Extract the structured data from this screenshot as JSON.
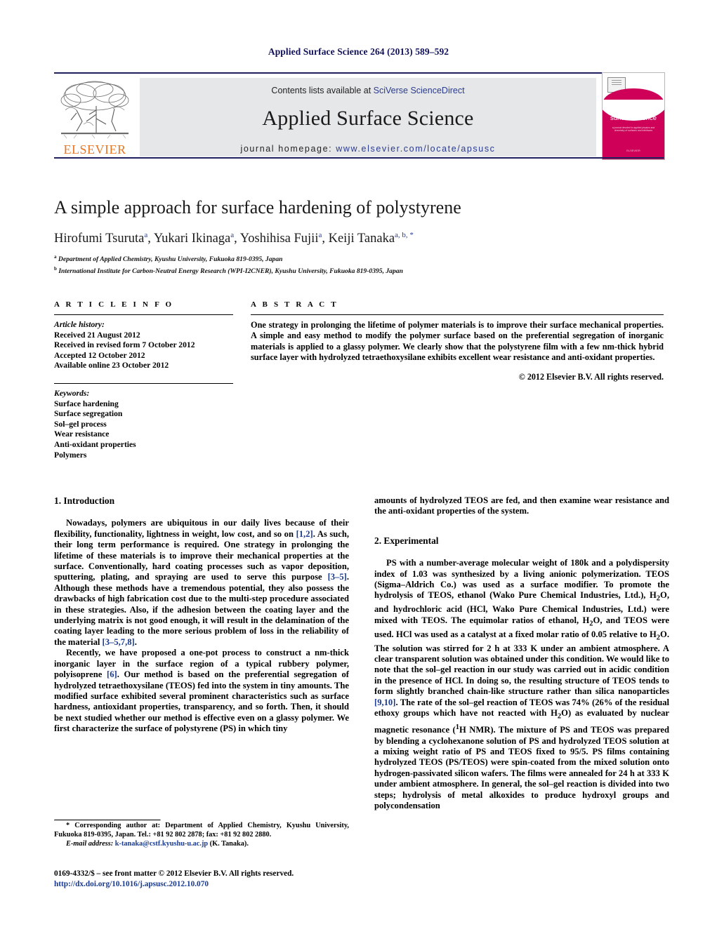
{
  "running_head": "Applied Surface Science 264 (2013) 589–592",
  "banner": {
    "publisher_wordmark": "ELSEVIER",
    "contents_prefix": "Contents lists available at ",
    "contents_link": "SciVerse ScienceDirect",
    "journal_title": "Applied Surface Science",
    "homepage_label": "journal homepage:",
    "homepage_url": "www.elsevier.com/locate/apsusc",
    "cover": {
      "title_line1": "applied",
      "title_line2": "surface science",
      "subtitle": "a journal devoted to applied physics and chemistry of surfaces and interfaces",
      "footer": "ELSEVIER"
    },
    "accent_color": "#ce0058",
    "link_color": "#2a3b8f",
    "rule_color": "#20205e"
  },
  "title_block": {
    "title": "A simple approach for surface hardening of polystyrene",
    "authors": [
      {
        "name": "Hirofumi Tsuruta",
        "marks": "a"
      },
      {
        "name": "Yukari Ikinaga",
        "marks": "a"
      },
      {
        "name": "Yoshihisa Fujii",
        "marks": "a"
      },
      {
        "name": "Keiji Tanaka",
        "marks": "a, b, *"
      }
    ],
    "affiliations": [
      {
        "mark": "a",
        "text": "Department of Applied Chemistry, Kyushu University, Fukuoka 819-0395, Japan"
      },
      {
        "mark": "b",
        "text": "International Institute for Carbon-Neutral Energy Research (WPI-I2CNER), Kyushu University, Fukuoka 819-0395, Japan"
      }
    ]
  },
  "article_info": {
    "heading": "A R T I C L E   I N F O",
    "history_label": "Article history:",
    "history": [
      "Received 21 August 2012",
      "Received in revised form 7 October 2012",
      "Accepted 12 October 2012",
      "Available online 23 October 2012"
    ],
    "keywords_label": "Keywords:",
    "keywords": [
      "Surface hardening",
      "Surface segregation",
      "Sol–gel process",
      "Wear resistance",
      "Anti-oxidant properties",
      "Polymers"
    ]
  },
  "abstract": {
    "heading": "A B S T R A C T",
    "text": "One strategy in prolonging the lifetime of polymer materials is to improve their surface mechanical properties. A simple and easy method to modify the polymer surface based on the preferential segregation of inorganic materials is applied to a glassy polymer. We clearly show that the polystyrene film with a few nm-thick hybrid surface layer with hydrolyzed tetraethoxysilane exhibits excellent wear resistance and anti-oxidant properties.",
    "rights": "© 2012 Elsevier B.V. All rights reserved."
  },
  "body": {
    "left": {
      "section_heading": "1.  Introduction",
      "paragraph_1_a": "Nowadays, polymers are ubiquitous in our daily lives because of their flexibility, functionality, lightness in weight, low cost, and so on ",
      "paragraph_1_cite1": "[1,2]",
      "paragraph_1_b": ". As such, their long term performance is required. One strategy in prolonging the lifetime of these materials is to improve their mechanical properties at the surface. Conventionally, hard coating processes such as vapor deposition, sputtering, plating, and spraying are used to serve this purpose ",
      "paragraph_1_cite2": "[3–5]",
      "paragraph_1_c": ". Although these methods have a tremendous potential, they also possess the drawbacks of high fabrication cost due to the multi-step procedure associated in these strategies. Also, if the adhesion between the coating layer and the underlying matrix is not good enough, it will result in the delamination of the coating layer leading to the more serious problem of loss in the reliability of the material ",
      "paragraph_1_cite3": "[3–5,7,8]",
      "paragraph_1_d": ".",
      "paragraph_2_a": "Recently, we have proposed a one-pot process to construct a nm-thick inorganic layer in the surface region of a typical rubbery polymer, polyisoprene ",
      "paragraph_2_cite1": "[6]",
      "paragraph_2_b": ". Our method is based on the preferential segregation of hydrolyzed tetraethoxysilane (TEOS) fed into the system in tiny amounts. The modified surface exhibited several prominent characteristics such as surface hardness, antioxidant properties, transparency, and so forth. Then, it should be next studied whether our method is effective even on a glassy polymer. We first characterize the surface of polystyrene (PS) in which tiny"
    },
    "right": {
      "continued": "amounts of hydrolyzed TEOS are fed, and then examine wear resistance and the anti-oxidant properties of the system.",
      "section_heading": "2.  Experimental",
      "paragraph_1_a": "PS with a number-average molecular weight of 180k and a polydispersity index of 1.03 was synthesized by a living anionic polymerization. TEOS (Sigma–Aldrich Co.) was used as a surface modifier. To promote the hydrolysis of TEOS, ethanol (Wako Pure Chemical Industries, Ltd.), H",
      "sub_2_a": "2",
      "paragraph_1_b": "O, and hydrochloric acid (HCl, Wako Pure Chemical Industries, Ltd.) were mixed with TEOS. The equimolar ratios of ethanol, H",
      "sub_2_b": "2",
      "paragraph_1_c": "O, and TEOS were used. HCl was used as a catalyst at a fixed molar ratio of 0.05 relative to H",
      "sub_2_c": "2",
      "paragraph_1_d": "O. The solution was stirred for 2 h at 333 K under an ambient atmosphere. A clear transparent solution was obtained under this condition. We would like to note that the sol–gel reaction in our study was carried out in acidic condition in the presence of HCl. In doing so, the resulting structure of TEOS tends to form slightly branched chain-like structure rather than silica nanoparticles ",
      "paragraph_1_cite": "[9,10]",
      "paragraph_1_e": ". The rate of the sol–gel reaction of TEOS was 74% (26% of the residual ethoxy groups which have not reacted with H",
      "sub_2_d": "2",
      "paragraph_1_f": "O) as evaluated by nuclear magnetic resonance (",
      "sup_1": "1",
      "paragraph_1_g": "H NMR). The mixture of PS and TEOS was prepared by blending a cyclohexanone solution of PS and hydrolyzed TEOS solution at a mixing weight ratio of PS and TEOS fixed to 95/5. PS films containing hydrolyzed TEOS (PS/TEOS) were spin-coated from the mixed solution onto hydrogen-passivated silicon wafers. The films were annealed for 24 h at 333 K under ambient atmosphere. In general, the sol–gel reaction is divided into two steps; hydrolysis of metal alkoxides to produce hydroxyl groups and polycondensation"
    }
  },
  "footnote": {
    "star": "*",
    "corr_a": " Corresponding author at: Department of Applied Chemistry, Kyushu University, Fukuoka 819-0395, Japan. Tel.: +81 92 802 2878; fax: +81 92 802 2880.",
    "email_label": "E-mail address:",
    "email": "k-tanaka@cstf.kyushu-u.ac.jp",
    "email_suffix": " (K. Tanaka)."
  },
  "footer": {
    "issn_line": "0169-4332/$ – see front matter © 2012 Elsevier B.V. All rights reserved.",
    "doi": "http://dx.doi.org/10.1016/j.apsusc.2012.10.070"
  }
}
